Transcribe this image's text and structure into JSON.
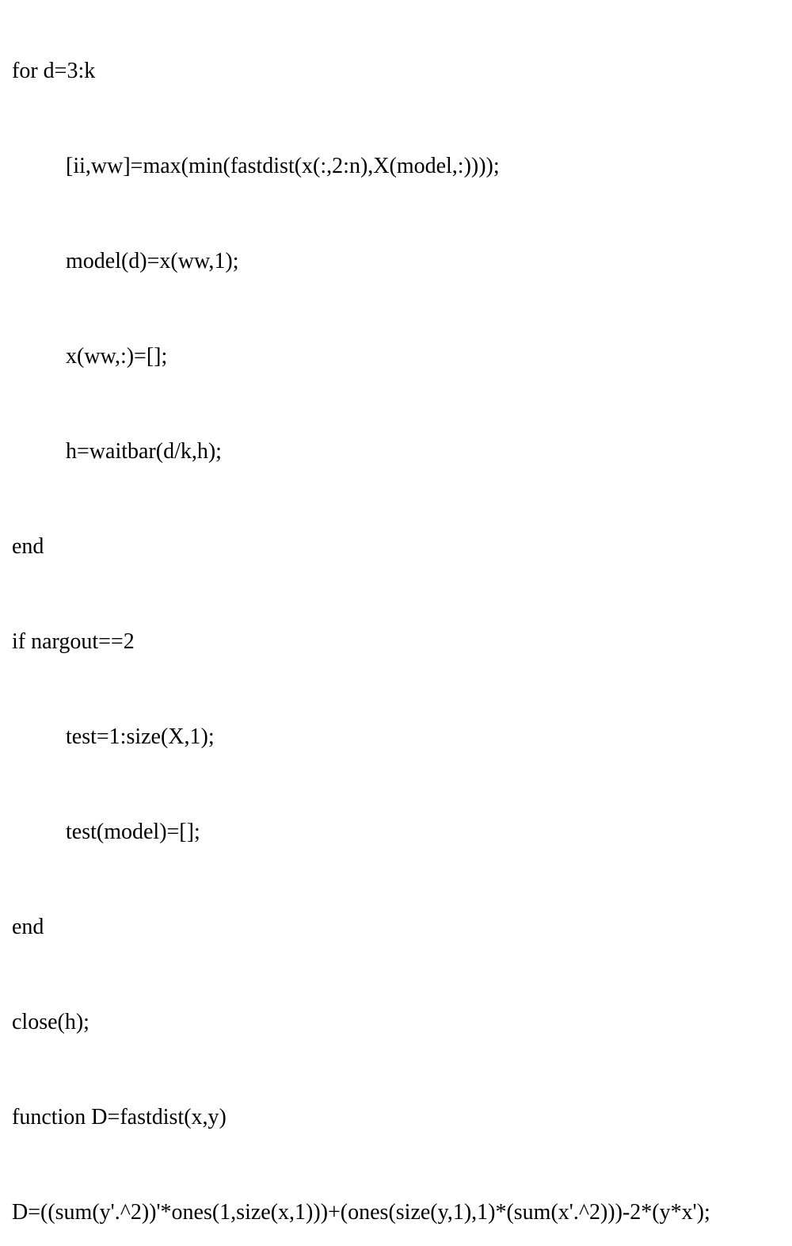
{
  "code": {
    "lines": [
      {
        "text": "for d=3:k",
        "indent": false
      },
      {
        "text": "[ii,ww]=max(min(fastdist(x(:,2:n),X(model,:))));",
        "indent": true
      },
      {
        "text": "model(d)=x(ww,1);",
        "indent": true
      },
      {
        "text": "x(ww,:)=[];",
        "indent": true
      },
      {
        "text": "h=waitbar(d/k,h);",
        "indent": true
      },
      {
        "text": "end",
        "indent": false
      },
      {
        "text": "if nargout==2",
        "indent": false
      },
      {
        "text": "test=1:size(X,1);",
        "indent": true
      },
      {
        "text": "test(model)=[];",
        "indent": true
      },
      {
        "text": "end",
        "indent": false
      },
      {
        "text": "close(h);",
        "indent": false
      },
      {
        "text": "function D=fastdist(x,y)",
        "indent": false
      },
      {
        "text": "D=((sum(y'.^2))'*ones(1,size(x,1)))+(ones(size(y,1),1)*(sum(x'.^2)))-2*(y*x');",
        "indent": false
      }
    ]
  }
}
